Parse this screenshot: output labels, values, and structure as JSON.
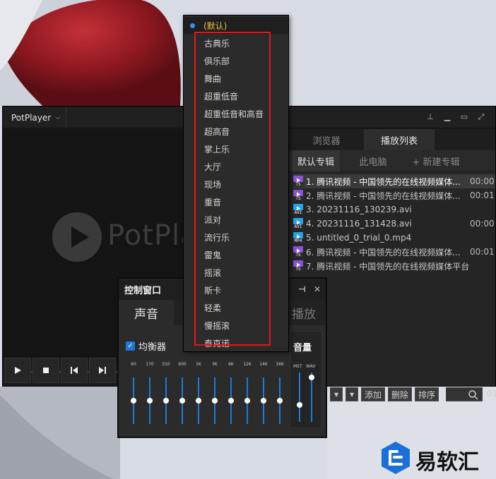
{
  "desktop": {
    "colors": {
      "wallpaper_red": "#a01c24",
      "wallpaper_light": "#dfe2ea"
    }
  },
  "app": {
    "menu_label": "PotPlayer",
    "logo_text": "PotPla",
    "window_controls": [
      "pin-icon",
      "minimize-icon",
      "maximize-icon",
      "fullscreen-icon",
      "close-icon"
    ]
  },
  "player_controls": [
    "play-icon",
    "stop-icon",
    "previous-icon",
    "next-icon"
  ],
  "playlist": {
    "top_tabs": [
      "浏览器",
      "播放列表"
    ],
    "active_top_tab": "播放列表",
    "sub_tabs": [
      "默认专辑",
      "此电脑",
      "+ 新建专辑"
    ],
    "items": [
      {
        "title": "1. 腾讯视频 - 中国领先的在线视频媒体...",
        "duration": "00:00:",
        "ext": "TS",
        "color": "#8a52d6"
      },
      {
        "title": "2. 腾讯视频 - 中国领先的在线视频媒体...",
        "duration": "00:01:",
        "ext": "TS",
        "color": "#8a52d6"
      },
      {
        "title": "3. 20231116_130239.avi",
        "duration": "",
        "ext": "AVI",
        "color": "#2aa2e8"
      },
      {
        "title": "4. 20231116_131428.avi",
        "duration": "00:00:",
        "ext": "AVI",
        "color": "#2aa2e8"
      },
      {
        "title": "5. untitled_0_trial_0.mp4",
        "duration": "",
        "ext": "MP4",
        "color": "#2aa2e8"
      },
      {
        "title": "6. 腾讯视频 - 中国领先的在线视频媒体...",
        "duration": "00:01:",
        "ext": "TS",
        "color": "#8a52d6"
      },
      {
        "title": "7. 腾讯视频 - 中国领先的在线视频媒体平台,海...",
        "duration": "",
        "ext": "TS",
        "color": "#8a52d6"
      }
    ],
    "toolbar": {
      "add": "添加",
      "delete": "删除",
      "sort": "排序",
      "time": "01:"
    }
  },
  "control_window": {
    "title": "控制窗口",
    "tabs": [
      "声音",
      "播放"
    ],
    "active_tab": "声音",
    "equalizer_label": "均衡器",
    "equalizer_enabled": true,
    "bands": [
      "60",
      "170",
      "310",
      "600",
      "1K",
      "3K",
      "6K",
      "12K",
      "14K",
      "16K"
    ],
    "band_levels": [
      0.5,
      0.5,
      0.5,
      0.5,
      0.5,
      0.5,
      0.5,
      0.5,
      0.5,
      0.5
    ],
    "volume_label": "音量",
    "volume_channels": [
      "MST",
      "WAV"
    ],
    "volume_levels": [
      0.35,
      0.9
    ]
  },
  "dropdown": {
    "default_label": "(默认)",
    "items": [
      "古典乐",
      "俱乐部",
      "舞曲",
      "超重低音",
      "超重低音和高音",
      "超高音",
      "掌上乐",
      "大厅",
      "现场",
      "重音",
      "派对",
      "流行乐",
      "雷鬼",
      "摇滚",
      "斯卡",
      "轻柔",
      "慢摇滚",
      "泰克诺"
    ],
    "highlight_color": "#e01818"
  },
  "watermark": {
    "text": "易软汇",
    "color": "#1a6fd8"
  }
}
